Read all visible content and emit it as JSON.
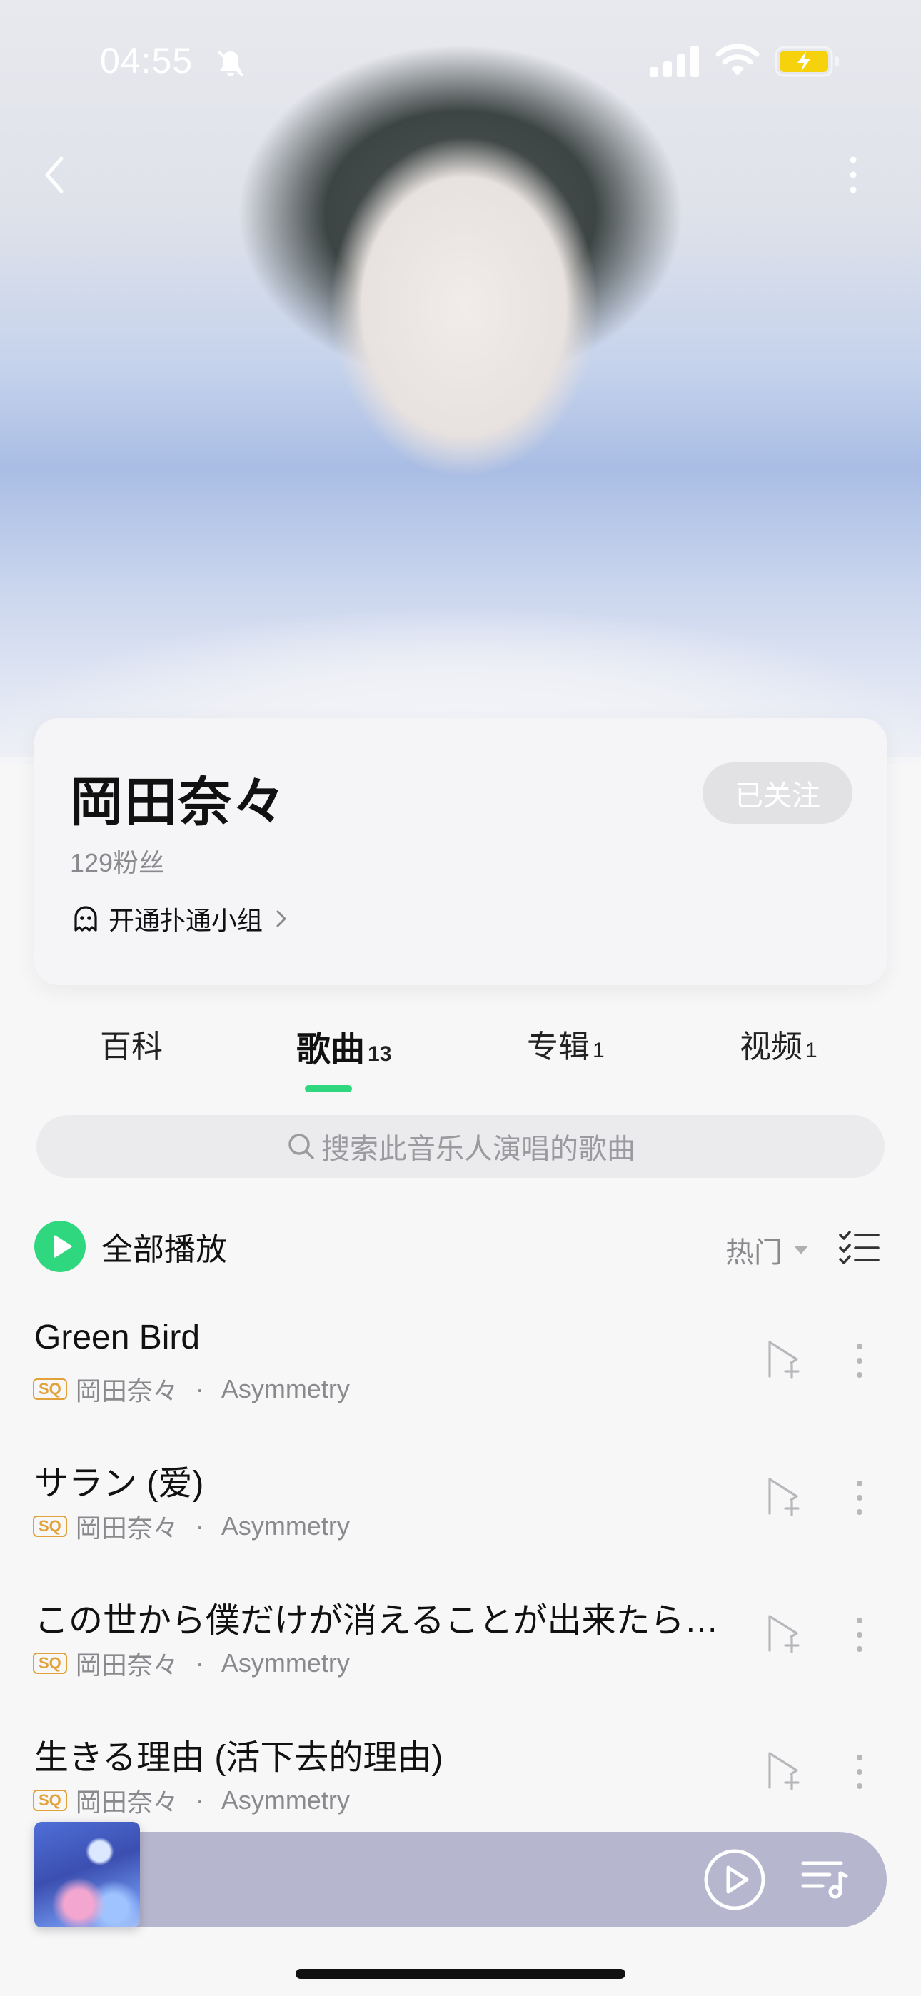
{
  "status_bar": {
    "time": "04:55"
  },
  "artist": {
    "name": "岡田奈々",
    "fans": "129粉丝",
    "follow_label": "已关注",
    "group_label": "开通扑通小组"
  },
  "tabs": [
    {
      "label": "百科",
      "count": "",
      "active": false
    },
    {
      "label": "歌曲",
      "count": "13",
      "active": true
    },
    {
      "label": "专辑",
      "count": "1",
      "active": false
    },
    {
      "label": "视频",
      "count": "1",
      "active": false
    }
  ],
  "search": {
    "placeholder": "搜索此音乐人演唱的歌曲"
  },
  "play_all": {
    "label": "全部播放",
    "sort_label": "热门"
  },
  "songs": [
    {
      "title": "Green Bird",
      "badge": "SQ",
      "artist": "岡田奈々",
      "separator": "·",
      "album": "Asymmetry"
    },
    {
      "title": "サラン (爱)",
      "badge": "SQ",
      "artist": "岡田奈々",
      "separator": "·",
      "album": "Asymmetry"
    },
    {
      "title": "この世から僕だけが消えることが出来たら…",
      "badge": "SQ",
      "artist": "岡田奈々",
      "separator": "·",
      "album": "Asymmetry"
    },
    {
      "title": "生きる理由 (活下去的理由)",
      "badge": "SQ",
      "artist": "岡田奈々",
      "separator": "·",
      "album": "Asymmetry"
    }
  ],
  "colors": {
    "accent_green": "#2fd77e",
    "sq_badge": "#e2a23b",
    "mini_player_bg": "#b7b6cf",
    "battery_charging": "#f5d20b"
  },
  "icons": [
    "bell-slash-icon",
    "signal-icon",
    "wifi-icon",
    "battery-charging-icon",
    "back-icon",
    "more-vertical-icon",
    "ghost-icon",
    "chevron-right-icon",
    "search-icon",
    "play-circle-icon",
    "caret-down-icon",
    "checklist-icon",
    "add-to-playlist-icon",
    "more-icon",
    "play-icon",
    "playlist-icon"
  ]
}
